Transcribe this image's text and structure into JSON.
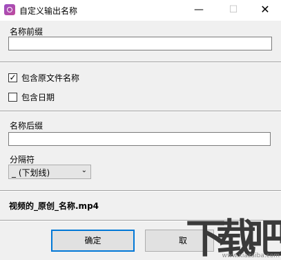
{
  "window": {
    "title": "自定义输出名称",
    "minimize": "—",
    "maximize": "☐",
    "close": "✕"
  },
  "prefix": {
    "label": "名称前缀",
    "value": ""
  },
  "options": {
    "include_original": {
      "label": "包含原文件名称",
      "checked": true,
      "tick": "✓"
    },
    "include_date": {
      "label": "包含日期",
      "checked": false,
      "tick": ""
    }
  },
  "suffix": {
    "label": "名称后缀",
    "value": ""
  },
  "separator": {
    "label": "分隔符",
    "selected": "_ (下划线)",
    "chevron": "⌄"
  },
  "preview": {
    "text": "视频的_原创_名称.mp4"
  },
  "buttons": {
    "ok": "确定",
    "cancel": "取"
  },
  "watermark": {
    "glyphs": "下载吧",
    "url": "www.xiazaiba.com"
  },
  "colors": {
    "accent": "#0078d7",
    "icon": "#b04aa8"
  }
}
